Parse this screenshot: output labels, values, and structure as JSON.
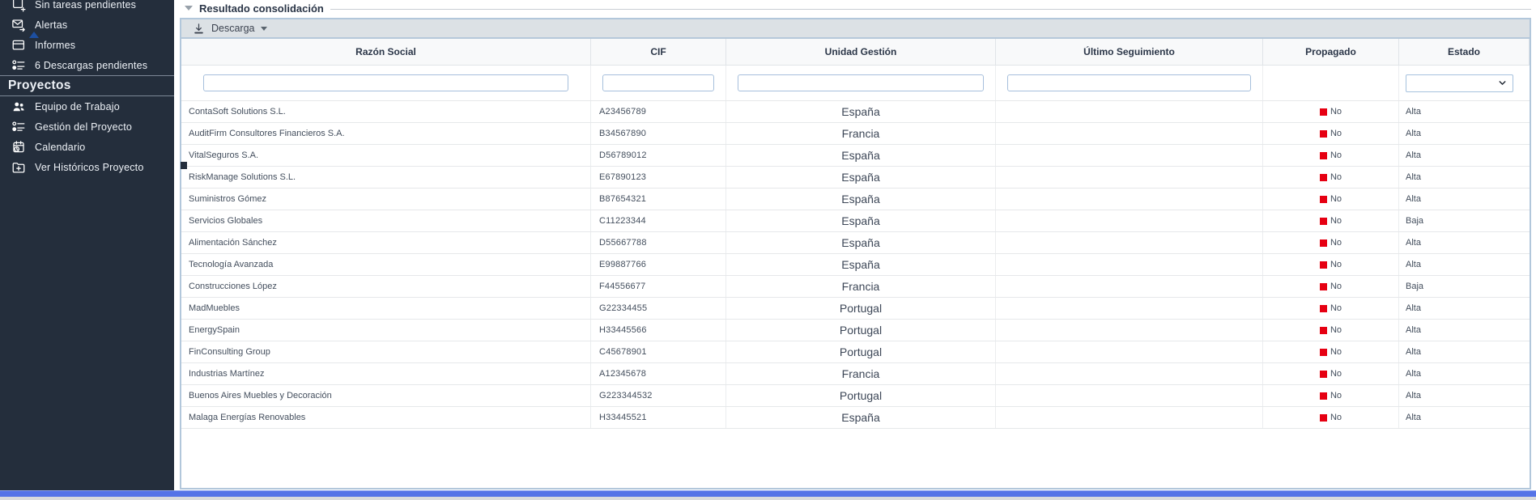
{
  "sidebar": {
    "items": [
      {
        "label": "Sin tareas pendientes",
        "icon": "tasks-plus-icon"
      },
      {
        "label": "Alertas",
        "icon": "mail-alert-icon"
      },
      {
        "label": "Informes",
        "icon": "report-folder-icon"
      },
      {
        "label": "6 Descargas pendientes",
        "icon": "checklist-icon"
      }
    ],
    "section_title": "Proyectos",
    "project_items": [
      {
        "label": "Equipo de Trabajo",
        "icon": "team-icon"
      },
      {
        "label": "Gestión del Proyecto",
        "icon": "checklist-icon"
      },
      {
        "label": "Calendario",
        "icon": "calendar-clock-icon"
      },
      {
        "label": "Ver Históricos Proyecto",
        "icon": "folder-plus-icon"
      }
    ]
  },
  "panel": {
    "title": "Resultado consolidación"
  },
  "toolbar": {
    "download_label": "Descarga"
  },
  "table": {
    "columns": [
      {
        "label": "Razón Social"
      },
      {
        "label": "CIF"
      },
      {
        "label": "Unidad Gestión"
      },
      {
        "label": "Último Seguimiento"
      },
      {
        "label": "Propagado"
      },
      {
        "label": "Estado"
      }
    ],
    "filters": {
      "razon_social": "",
      "cif": "",
      "unidad_gestion": "",
      "ultimo_seguimiento": "",
      "estado": ""
    },
    "rows": [
      {
        "razon_social": "ContaSoft Solutions S.L.",
        "cif": "A23456789",
        "unidad_gestion": "España",
        "ultimo_seguimiento": "",
        "propagado": "No",
        "estado": "Alta"
      },
      {
        "razon_social": "AuditFirm Consultores Financieros S.A.",
        "cif": "B34567890",
        "unidad_gestion": "Francia",
        "ultimo_seguimiento": "",
        "propagado": "No",
        "estado": "Alta"
      },
      {
        "razon_social": "VitalSeguros S.A.",
        "cif": "D56789012",
        "unidad_gestion": "España",
        "ultimo_seguimiento": "",
        "propagado": "No",
        "estado": "Alta"
      },
      {
        "razon_social": "RiskManage Solutions S.L.",
        "cif": "E67890123",
        "unidad_gestion": "España",
        "ultimo_seguimiento": "",
        "propagado": "No",
        "estado": "Alta"
      },
      {
        "razon_social": "Suministros Gómez",
        "cif": "B87654321",
        "unidad_gestion": "España",
        "ultimo_seguimiento": "",
        "propagado": "No",
        "estado": "Alta"
      },
      {
        "razon_social": "Servicios Globales",
        "cif": "C11223344",
        "unidad_gestion": "España",
        "ultimo_seguimiento": "",
        "propagado": "No",
        "estado": "Baja"
      },
      {
        "razon_social": "Alimentación Sánchez",
        "cif": "D55667788",
        "unidad_gestion": "España",
        "ultimo_seguimiento": "",
        "propagado": "No",
        "estado": "Alta"
      },
      {
        "razon_social": "Tecnología Avanzada",
        "cif": "E99887766",
        "unidad_gestion": "España",
        "ultimo_seguimiento": "",
        "propagado": "No",
        "estado": "Alta"
      },
      {
        "razon_social": "Construcciones López",
        "cif": "F44556677",
        "unidad_gestion": "Francia",
        "ultimo_seguimiento": "",
        "propagado": "No",
        "estado": "Baja"
      },
      {
        "razon_social": "MadMuebles",
        "cif": "G22334455",
        "unidad_gestion": "Portugal",
        "ultimo_seguimiento": "",
        "propagado": "No",
        "estado": "Alta"
      },
      {
        "razon_social": "EnergySpain",
        "cif": "H33445566",
        "unidad_gestion": "Portugal",
        "ultimo_seguimiento": "",
        "propagado": "No",
        "estado": "Alta"
      },
      {
        "razon_social": "FinConsulting Group",
        "cif": "C45678901",
        "unidad_gestion": "Portugal",
        "ultimo_seguimiento": "",
        "propagado": "No",
        "estado": "Alta"
      },
      {
        "razon_social": "Industrias Martínez",
        "cif": "A12345678",
        "unidad_gestion": "Francia",
        "ultimo_seguimiento": "",
        "propagado": "No",
        "estado": "Alta"
      },
      {
        "razon_social": "Buenos Aires Muebles y Decoración",
        "cif": "G223344532",
        "unidad_gestion": "Portugal",
        "ultimo_seguimiento": "",
        "propagado": "No",
        "estado": "Alta"
      },
      {
        "razon_social": "Malaga Energías Renovables",
        "cif": "H33445521",
        "unidad_gestion": "España",
        "ultimo_seguimiento": "",
        "propagado": "No",
        "estado": "Alta"
      }
    ]
  },
  "colors": {
    "propagado_flag": "#e60012",
    "footer_accent": "#5573e7",
    "sidebar_background": "#242e3c",
    "alert_triangle": "#1d4fa1"
  }
}
